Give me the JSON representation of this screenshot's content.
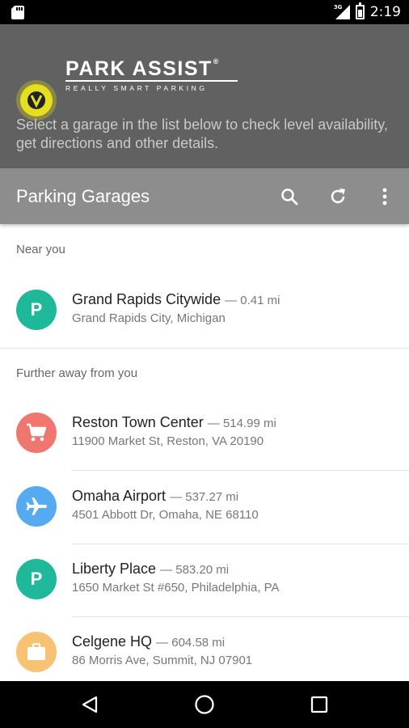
{
  "status_bar": {
    "network": "3G",
    "time": "2:19"
  },
  "header": {
    "brand_name": "PARK ASSIST",
    "brand_registered": "®",
    "brand_tagline": "REALLY SMART PARKING",
    "description": "Select a garage in the list below to check level availability, get directions and other details."
  },
  "toolbar": {
    "title": "Parking Garages",
    "actions": [
      "search-icon",
      "refresh-icon",
      "more-vert-icon"
    ]
  },
  "sections": {
    "near": "Near you",
    "further": "Further away from you"
  },
  "garages": [
    {
      "name": "Grand Rapids Citywide",
      "distance": "— 0.41 mi",
      "address": "Grand Rapids City, Michigan",
      "icon": "parking-icon",
      "color": "#1eb99a"
    },
    {
      "name": "Reston Town Center",
      "distance": "— 514.99 mi",
      "address": "11900 Market St, Reston, VA 20190",
      "icon": "cart-icon",
      "color": "#f0776f"
    },
    {
      "name": "Omaha Airport",
      "distance": "— 537.27 mi",
      "address": "4501 Abbott Dr, Omaha, NE 68110",
      "icon": "airplane-icon",
      "color": "#56aaf0"
    },
    {
      "name": "Liberty Place",
      "distance": "— 583.20 mi",
      "address": "1650 Market St #650, Philadelphia, PA",
      "icon": "parking-icon",
      "color": "#1eb99a"
    },
    {
      "name": "Celgene HQ",
      "distance": "— 604.58 mi",
      "address": "86 Morris Ave, Summit, NJ 07901",
      "icon": "briefcase-icon",
      "color": "#f7c272"
    }
  ],
  "avatar_letter": "P",
  "colors": {
    "header_bg": "#616161",
    "toolbar_bg": "#8d8d8d",
    "logo_accent": "#e6df20"
  }
}
